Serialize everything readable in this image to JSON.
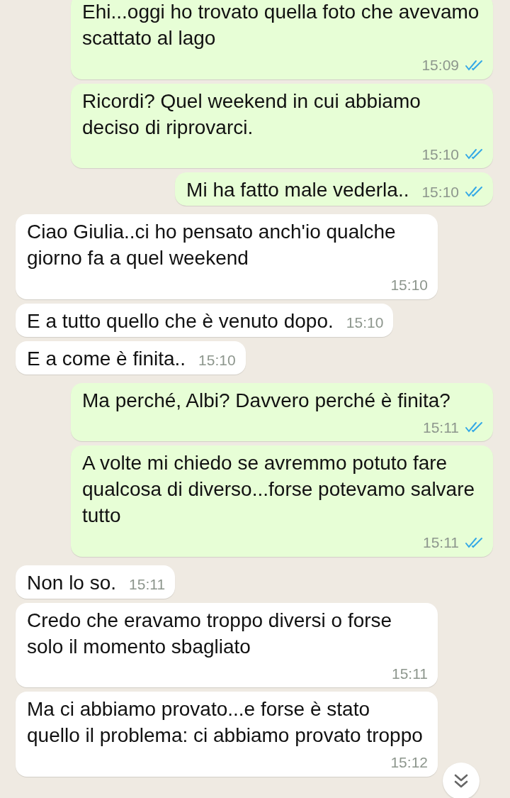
{
  "messages": [
    {
      "kind": "outgoing",
      "text": "Ehi...oggi ho trovato quella foto che avevamo scattato al lago",
      "time": "15:09",
      "read": true
    },
    {
      "kind": "outgoing",
      "text": "Ricordi? Quel weekend in cui abbiamo deciso di riprovarci.",
      "time": "15:10",
      "read": true
    },
    {
      "kind": "outgoing",
      "text": "Mi ha fatto male vederla..",
      "time": "15:10",
      "read": true
    },
    {
      "kind": "incoming",
      "text": "Ciao Giulia..ci ho pensato anch'io qualche giorno fa a quel weekend",
      "time": "15:10"
    },
    {
      "kind": "incoming",
      "text": "E a tutto quello che è venuto dopo.",
      "time": "15:10"
    },
    {
      "kind": "incoming",
      "text": "E a come è finita..",
      "time": "15:10"
    },
    {
      "kind": "outgoing",
      "text": "Ma perché, Albi? Davvero perché è finita?",
      "time": "15:11",
      "read": true
    },
    {
      "kind": "outgoing",
      "text": "A volte mi chiedo se avremmo potuto fare qualcosa di diverso...forse potevamo salvare tutto",
      "time": "15:11",
      "read": true
    },
    {
      "kind": "incoming",
      "text": "Non lo so.",
      "time": "15:11"
    },
    {
      "kind": "incoming",
      "text": "Credo che eravamo troppo diversi o forse solo il momento sbagliato",
      "time": "15:11"
    },
    {
      "kind": "incoming",
      "text": "Ma ci abbiamo provato...e forse è stato quello il problema: ci abbiamo provato troppo",
      "time": "15:12"
    }
  ]
}
